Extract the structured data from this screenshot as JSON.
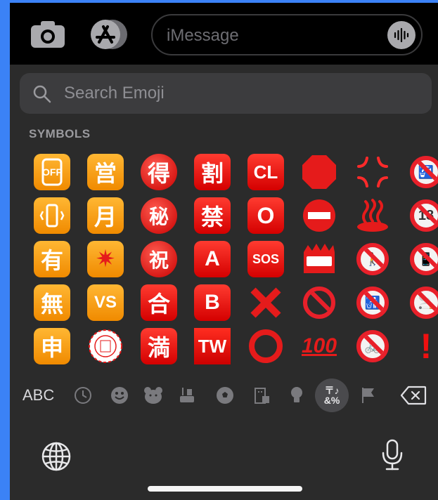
{
  "top_bar": {
    "camera_icon": "camera-icon",
    "app_store_icon": "app-store-icon",
    "message_placeholder": "iMessage",
    "voice_icon": "waveform-icon"
  },
  "keyboard": {
    "search_placeholder": "Search Emoji",
    "section_label": "SYMBOLS",
    "emoji_rows": [
      [
        "OFF",
        "営",
        "得",
        "割",
        "CL",
        "",
        "",
        ""
      ],
      [
        "",
        "月",
        "秘",
        "禁",
        "O",
        "",
        "",
        "18"
      ],
      [
        "有",
        "✷",
        "祝",
        "A",
        "SOS",
        "",
        "",
        ""
      ],
      [
        "無",
        "VS",
        "合",
        "B",
        "✕",
        "",
        "",
        ""
      ],
      [
        "申",
        "",
        "満",
        "TW",
        "◯",
        "100",
        "",
        "!"
      ]
    ],
    "categories": {
      "abc_label": "ABC",
      "symbols_active_label": "〒♪\n&%"
    },
    "accent_red": "#e8202a",
    "accent_orange": "#f5a000"
  }
}
